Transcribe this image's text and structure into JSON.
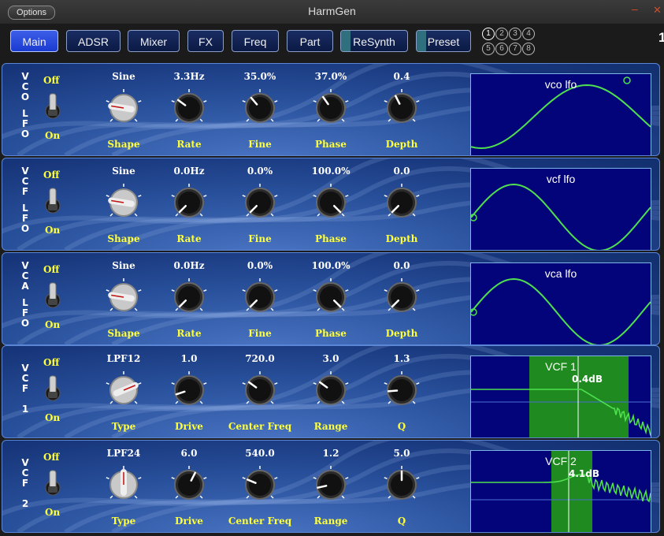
{
  "window": {
    "title": "HarmGen",
    "options_label": "Options",
    "minimize": "–",
    "close": "✕"
  },
  "tabs": [
    {
      "label": "Main",
      "active": true
    },
    {
      "label": "ADSR"
    },
    {
      "label": "Mixer"
    },
    {
      "label": "FX"
    },
    {
      "label": "Freq"
    },
    {
      "label": "Part"
    },
    {
      "label": "ReSynth",
      "stripe": true
    },
    {
      "label": "Preset",
      "stripe": true
    }
  ],
  "part_selector": [
    "1",
    "2",
    "3",
    "4",
    "5",
    "6",
    "7",
    "8"
  ],
  "part_selected": "1",
  "edge_text": "1",
  "colors": {
    "accent_yellow": "#ffff3a",
    "display_bg": "#04047a",
    "curve_green": "#4ee04e",
    "filter_band": "#1f8a1f"
  },
  "rows": [
    {
      "label": [
        "V",
        "C",
        "O",
        "",
        "L",
        "F",
        "O"
      ],
      "off": "Off",
      "on": "On",
      "controls": [
        {
          "value": "Sine",
          "name": "Shape",
          "type": "selector",
          "level": 0.2
        },
        {
          "value": "3.3Hz",
          "name": "Rate",
          "level": 0.3
        },
        {
          "value": "35.0%",
          "name": "Fine",
          "level": 0.35
        },
        {
          "value": "37.0%",
          "name": "Phase",
          "level": 0.37
        },
        {
          "value": "0.4",
          "name": "Depth",
          "level": 0.4
        }
      ],
      "display": {
        "title": "vco lfo"
      }
    },
    {
      "label": [
        "V",
        "C",
        "F",
        "",
        "L",
        "F",
        "O"
      ],
      "off": "Off",
      "on": "On",
      "controls": [
        {
          "value": "Sine",
          "name": "Shape",
          "type": "selector",
          "level": 0.2
        },
        {
          "value": "0.0Hz",
          "name": "Rate",
          "level": 0.0
        },
        {
          "value": "0.0%",
          "name": "Fine",
          "level": 0.0
        },
        {
          "value": "100.0%",
          "name": "Phase",
          "level": 1.0
        },
        {
          "value": "0.0",
          "name": "Depth",
          "level": 0.0
        }
      ],
      "display": {
        "title": "vcf lfo"
      }
    },
    {
      "label": [
        "V",
        "C",
        "A",
        "",
        "L",
        "F",
        "O"
      ],
      "off": "Off",
      "on": "On",
      "controls": [
        {
          "value": "Sine",
          "name": "Shape",
          "type": "selector",
          "level": 0.2
        },
        {
          "value": "0.0Hz",
          "name": "Rate",
          "level": 0.0
        },
        {
          "value": "0.0%",
          "name": "Fine",
          "level": 0.0
        },
        {
          "value": "100.0%",
          "name": "Phase",
          "level": 1.0
        },
        {
          "value": "0.0",
          "name": "Depth",
          "level": 0.0
        }
      ],
      "display": {
        "title": "vca lfo"
      }
    },
    {
      "label": [
        "V",
        "C",
        "F",
        "",
        "1"
      ],
      "off": "Off",
      "on": "On",
      "controls": [
        {
          "value": "LPF12",
          "name": "Type",
          "type": "selector",
          "level": 0.75
        },
        {
          "value": "1.0",
          "name": "Drive",
          "level": 0.1
        },
        {
          "value": "720.0",
          "name": "Center Freq",
          "level": 0.3
        },
        {
          "value": "3.0",
          "name": "Range",
          "level": 0.3
        },
        {
          "value": "1.3",
          "name": "Q",
          "level": 0.15
        }
      ],
      "display": {
        "title": "VCF 1",
        "readout": "0.4dB"
      }
    },
    {
      "label": [
        "V",
        "C",
        "F",
        "",
        "2"
      ],
      "off": "Off",
      "on": "On",
      "controls": [
        {
          "value": "LPF24",
          "name": "Type",
          "type": "selector",
          "level": 0.5
        },
        {
          "value": "6.0",
          "name": "Drive",
          "level": 0.6
        },
        {
          "value": "540.0",
          "name": "Center Freq",
          "level": 0.25
        },
        {
          "value": "1.2",
          "name": "Range",
          "level": 0.12
        },
        {
          "value": "5.0",
          "name": "Q",
          "level": 0.5
        }
      ],
      "display": {
        "title": "VCF 2",
        "readout": "4.1dB"
      }
    }
  ]
}
